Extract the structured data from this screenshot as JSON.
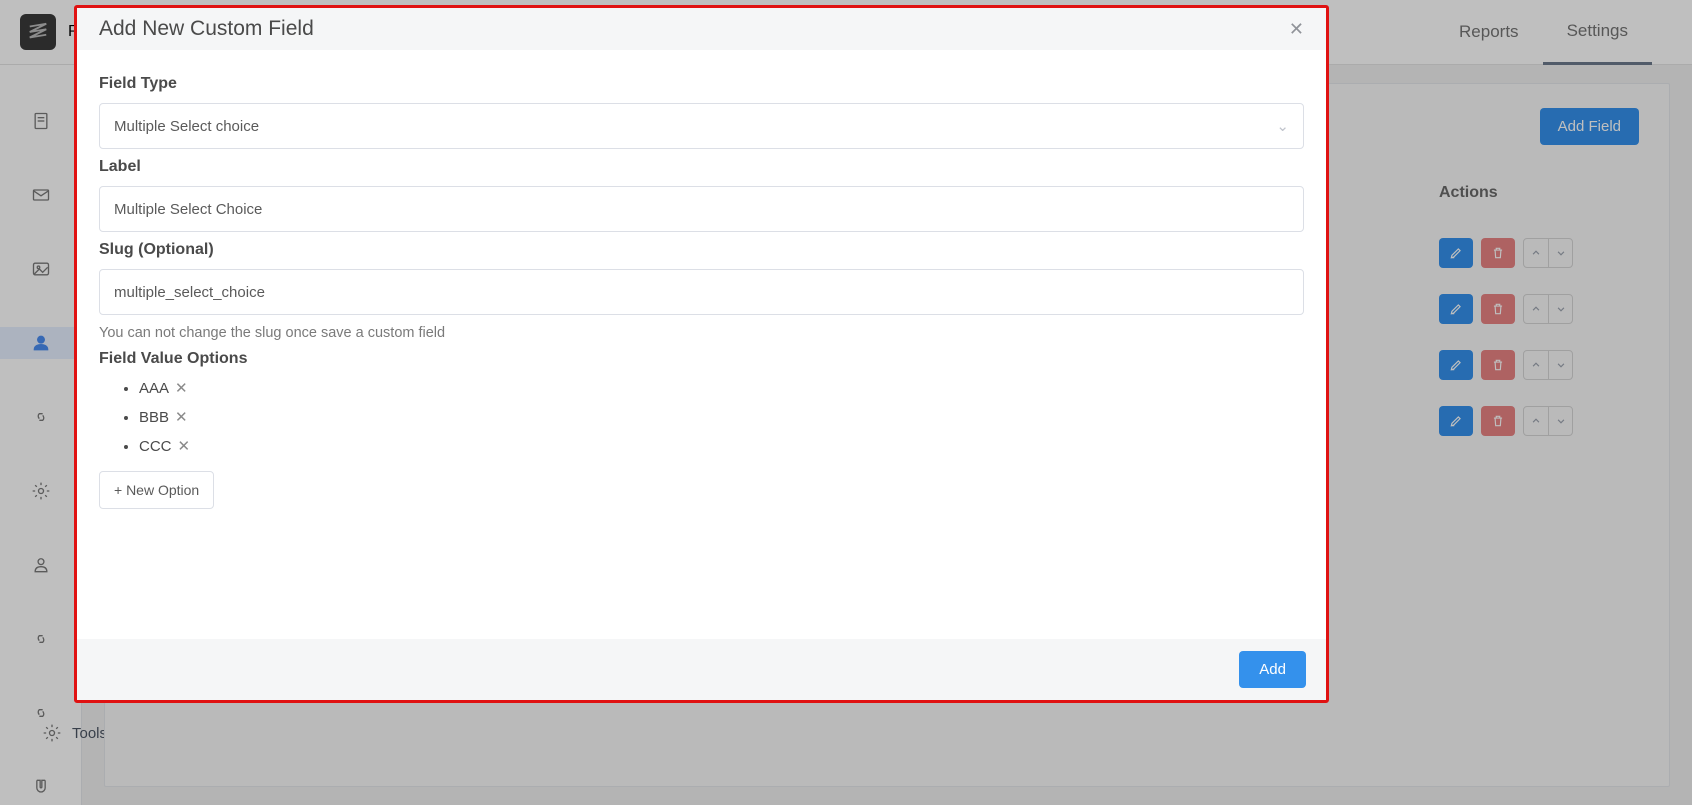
{
  "top": {
    "app_initial": "Pr",
    "tabs": {
      "reports": "Reports",
      "settings": "Settings"
    }
  },
  "page": {
    "add_field_button": "Add Field",
    "actions_heading": "Actions"
  },
  "sidebar_tools": "Tools",
  "modal": {
    "title": "Add New Custom Field",
    "field_type_label": "Field Type",
    "field_type_value": "Multiple Select choice",
    "label_label": "Label",
    "label_value": "Multiple Select Choice",
    "slug_label": "Slug (Optional)",
    "slug_value": "multiple_select_choice",
    "slug_help": "You can not change the slug once save a custom field",
    "options_label": "Field Value Options",
    "options": [
      "AAA",
      "BBB",
      "CCC"
    ],
    "new_option_button": "+ New Option",
    "add_button": "Add"
  }
}
